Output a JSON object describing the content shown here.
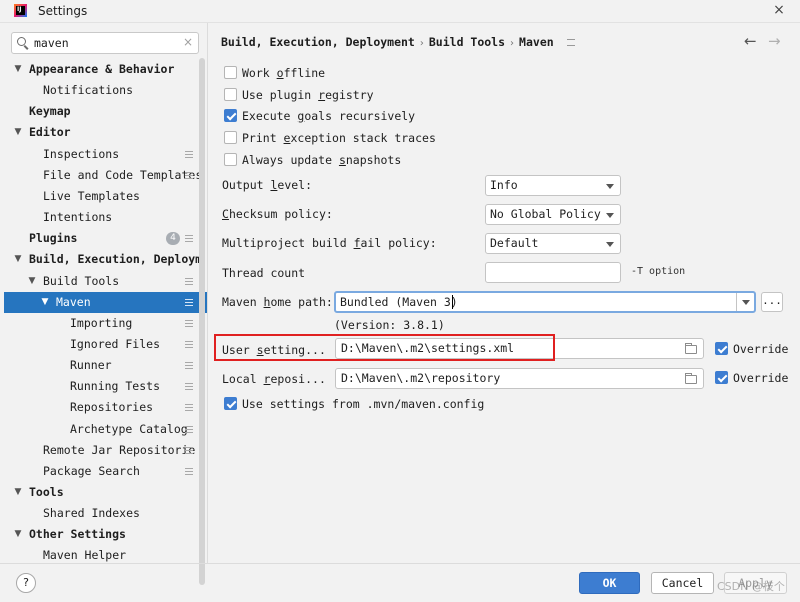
{
  "window": {
    "title": "Settings",
    "close_label": "×",
    "app_icon_letters": "IJ"
  },
  "search": {
    "value": "maven",
    "clear_label": "×"
  },
  "sidebar": {
    "items": [
      {
        "label": "Appearance & Behavior",
        "level": 0,
        "bold": true,
        "expanded": true
      },
      {
        "label": "Notifications",
        "level": 1
      },
      {
        "label": "Keymap",
        "level": 0,
        "bold": true
      },
      {
        "label": "Editor",
        "level": 0,
        "bold": true,
        "expanded": true
      },
      {
        "label": "Inspections",
        "level": 1,
        "page_icon": true
      },
      {
        "label": "File and Code Templates",
        "level": 1,
        "page_icon": true
      },
      {
        "label": "Live Templates",
        "level": 1
      },
      {
        "label": "Intentions",
        "level": 1
      },
      {
        "label": "Plugins",
        "level": 0,
        "bold": true,
        "badge": "4",
        "page_icon": true
      },
      {
        "label": "Build, Execution, Deploym",
        "level": 0,
        "bold": true,
        "expanded": true
      },
      {
        "label": "Build Tools",
        "level": 1,
        "expanded": true,
        "page_icon": true
      },
      {
        "label": "Maven",
        "level": 2,
        "expanded": true,
        "selected": true,
        "page_icon": true
      },
      {
        "label": "Importing",
        "level": 3,
        "page_icon": true
      },
      {
        "label": "Ignored Files",
        "level": 3,
        "page_icon": true
      },
      {
        "label": "Runner",
        "level": 3,
        "page_icon": true
      },
      {
        "label": "Running Tests",
        "level": 3,
        "page_icon": true
      },
      {
        "label": "Repositories",
        "level": 3,
        "page_icon": true
      },
      {
        "label": "Archetype Catalog",
        "level": 3,
        "page_icon": true
      },
      {
        "label": "Remote Jar Repositorie",
        "level": 1,
        "page_icon": true
      },
      {
        "label": "Package Search",
        "level": 1,
        "page_icon": true
      },
      {
        "label": "Tools",
        "level": 0,
        "bold": true,
        "expanded": true
      },
      {
        "label": "Shared Indexes",
        "level": 1
      },
      {
        "label": "Other Settings",
        "level": 0,
        "bold": true,
        "expanded": true
      },
      {
        "label": "Maven Helper",
        "level": 1
      }
    ]
  },
  "breadcrumb": {
    "part1": "Build, Execution, Deployment",
    "part2": "Build Tools",
    "part3": "Maven",
    "sep": "›"
  },
  "nav": {
    "back": "←",
    "forward": "→"
  },
  "checkboxes": {
    "work_offline": {
      "pre": "Work ",
      "mn": "o",
      "post": "ffline",
      "checked": false
    },
    "plugin_registry": {
      "pre": "Use plugin ",
      "mn": "r",
      "post": "egistry",
      "checked": false
    },
    "execute_goals": {
      "pre": "Execute ",
      "mn": "g",
      "post": "oals recursively",
      "checked": true
    },
    "print_exception": {
      "pre": "Print ",
      "mn": "e",
      "post": "xception stack traces",
      "checked": false
    },
    "always_update": {
      "pre": "Always update ",
      "mn": "s",
      "post": "napshots",
      "checked": false
    },
    "use_mvn_config": {
      "label": "Use settings from .mvn/maven.config",
      "checked": true
    }
  },
  "form": {
    "output_level": {
      "pre": "Output ",
      "mn": "l",
      "post": "evel:",
      "value": "Info"
    },
    "checksum_policy": {
      "pre": "",
      "mn": "C",
      "post": "hecksum policy:",
      "value": "No Global Policy"
    },
    "fail_policy": {
      "pre": "Multiproject build ",
      "mn": "f",
      "post": "ail policy:",
      "value": "Default"
    },
    "thread_count": {
      "label": "Thread count",
      "value": "",
      "hint": "-T option"
    },
    "maven_home": {
      "pre": "Maven ",
      "mn": "h",
      "post": "ome path:",
      "value": "Bundled (Maven 3)",
      "browse": "...",
      "version": "(Version: 3.8.1)"
    },
    "user_settings": {
      "pre": "User ",
      "mn": "s",
      "post": "etting...",
      "value": "D:\\Maven\\.m2\\settings.xml",
      "override_label": "Override",
      "override_checked": true
    },
    "local_repo": {
      "pre": "Local ",
      "mn": "r",
      "post": "eposi...",
      "value": "D:\\Maven\\.m2\\repository",
      "override_label": "Override",
      "override_checked": true
    }
  },
  "buttons": {
    "help": "?",
    "ok": "OK",
    "cancel": "Cancel",
    "apply": "Apply"
  },
  "watermark": "CSDN @枝个",
  "colors": {
    "accent": "#2675bf",
    "primary_button": "#3d7dd1",
    "highlight_border": "#e02020"
  }
}
